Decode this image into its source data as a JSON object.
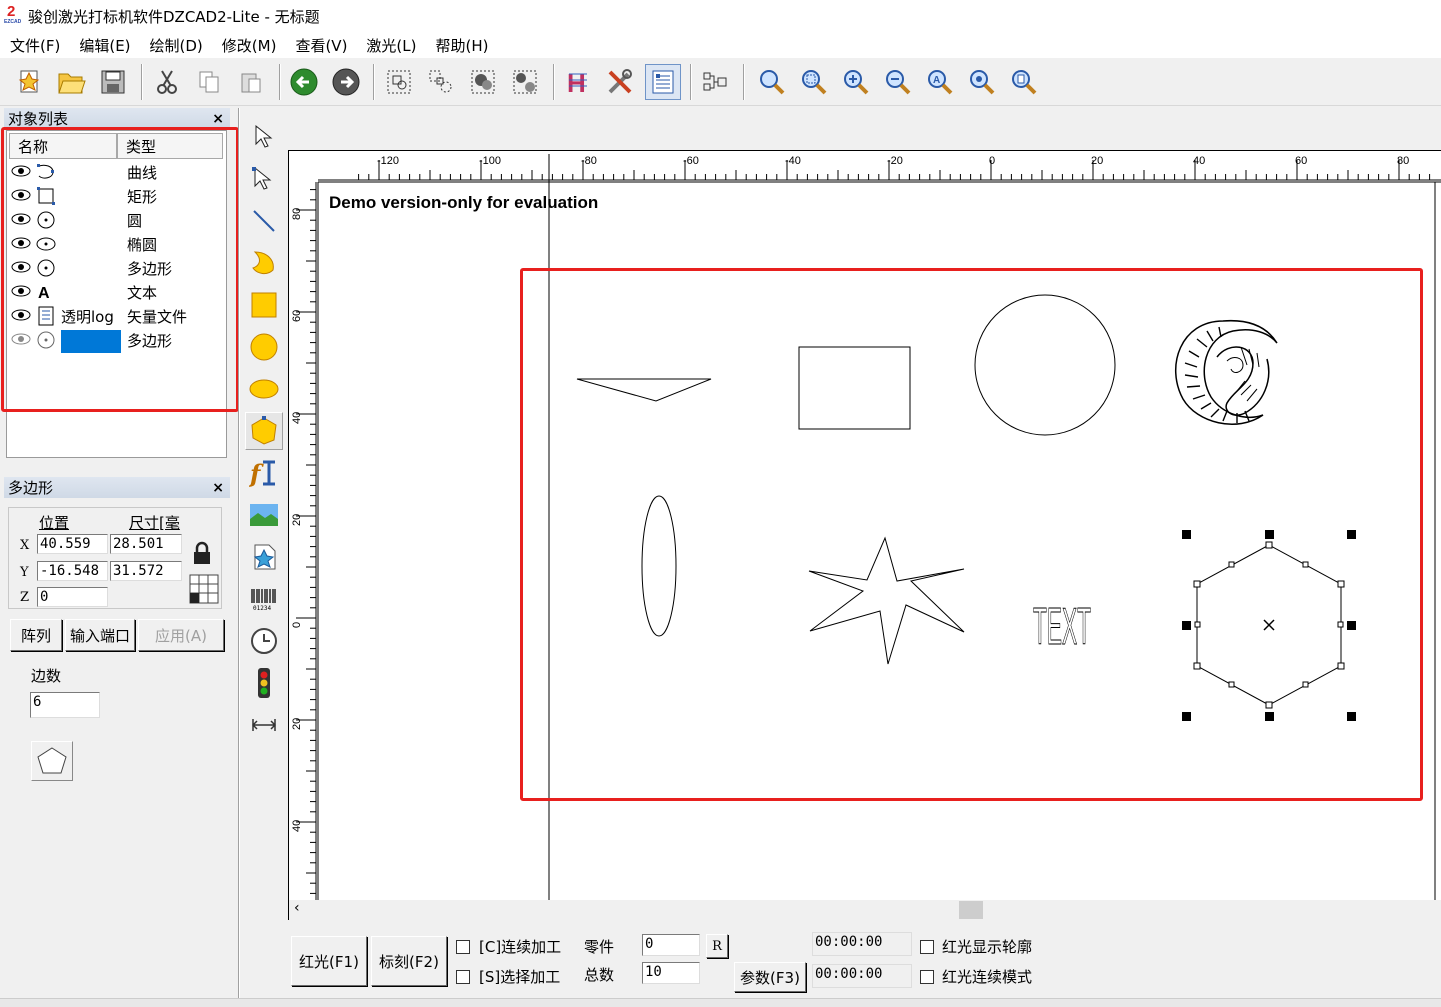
{
  "window": {
    "title": "骏创激光打标机软件DZCAD2-Lite  - 无标题",
    "logo_text": "EZCAD"
  },
  "menu": [
    "文件(F)",
    "编辑(E)",
    "绘制(D)",
    "修改(M)",
    "查看(V)",
    "激光(L)",
    "帮助(H)"
  ],
  "toolbar": {
    "buttons": [
      "new-icon",
      "open-icon",
      "save-icon",
      "cut-icon",
      "copy-icon",
      "paste-icon",
      "undo-icon",
      "redo-icon",
      "group-icon",
      "ungroup-icon",
      "combine-icon",
      "uncombine-icon",
      "hatch-icon",
      "tools-icon",
      "object-list-icon",
      "node-icon",
      "zoom-icon",
      "zoom-window-icon",
      "zoom-in-icon",
      "zoom-out-icon",
      "zoom-all-icon",
      "zoom-selected-icon",
      "zoom-page-icon"
    ]
  },
  "object_panel": {
    "title": "对象列表",
    "columns": [
      "名称",
      "类型"
    ],
    "rows": [
      {
        "name": "",
        "type": "曲线",
        "icon": "curve-icon"
      },
      {
        "name": "",
        "type": "矩形",
        "icon": "rectangle-icon"
      },
      {
        "name": "",
        "type": "圆",
        "icon": "circle-icon"
      },
      {
        "name": "",
        "type": "椭圆",
        "icon": "ellipse-icon"
      },
      {
        "name": "",
        "type": "多边形",
        "icon": "polygon-icon"
      },
      {
        "name": "",
        "type": "文本",
        "icon": "text-icon"
      },
      {
        "name": "透明log",
        "type": "矢量文件",
        "icon": "vector-file-icon"
      },
      {
        "name": "",
        "type": "多边形",
        "icon": "polygon-icon",
        "selected": true
      }
    ]
  },
  "prop_panel": {
    "title": "多边形",
    "pos_label": "位置",
    "size_label": "尺寸[毫",
    "x_label": "X",
    "y_label": "Y",
    "z_label": "Z",
    "x": "40.559",
    "y": "-16.548",
    "z": "0",
    "width": "28.501",
    "height": "31.572",
    "array_btn": "阵列",
    "input_port_btn": "输入端口",
    "apply_btn": "应用(A)",
    "sides_label": "边数",
    "sides": "6"
  },
  "drawing_tools": [
    "select-icon",
    "node-edit-icon",
    "line-icon",
    "curve-tool-icon",
    "rectangle-tool-icon",
    "circle-tool-icon",
    "ellipse-tool-icon",
    "polygon-tool-icon",
    "text-tool-icon",
    "bitmap-icon",
    "vector-import-icon",
    "barcode-icon",
    "timer-icon",
    "io-port-icon",
    "extend-axis-icon"
  ],
  "canvas": {
    "watermark": "Demo version-only for evaluation",
    "ruler_h": [
      "-120",
      "-100",
      "-80",
      "-60",
      "-40",
      "-20",
      "0",
      "20",
      "40",
      "60",
      "80"
    ],
    "ruler_v": [
      "80",
      "60",
      "40",
      "20",
      "0",
      "20",
      "40"
    ],
    "text_object": "TEXT"
  },
  "bottom": {
    "red_light_btn": "红光(F1)",
    "mark_btn": "标刻(F2)",
    "continuous_label": "[C]连续加工",
    "select_label": "[S]选择加工",
    "part_label": "零件",
    "total_label": "总数",
    "part_value": "0",
    "total_value": "10",
    "reset_btn": "R",
    "param_btn": "参数(F3)",
    "time1": "00:00:00",
    "time2": "00:00:00",
    "show_contour_label": "红光显示轮廓",
    "continuous_mode_label": "红光连续模式"
  },
  "colors": {
    "highlight": "#e8201e",
    "selection": "#0078d7"
  }
}
